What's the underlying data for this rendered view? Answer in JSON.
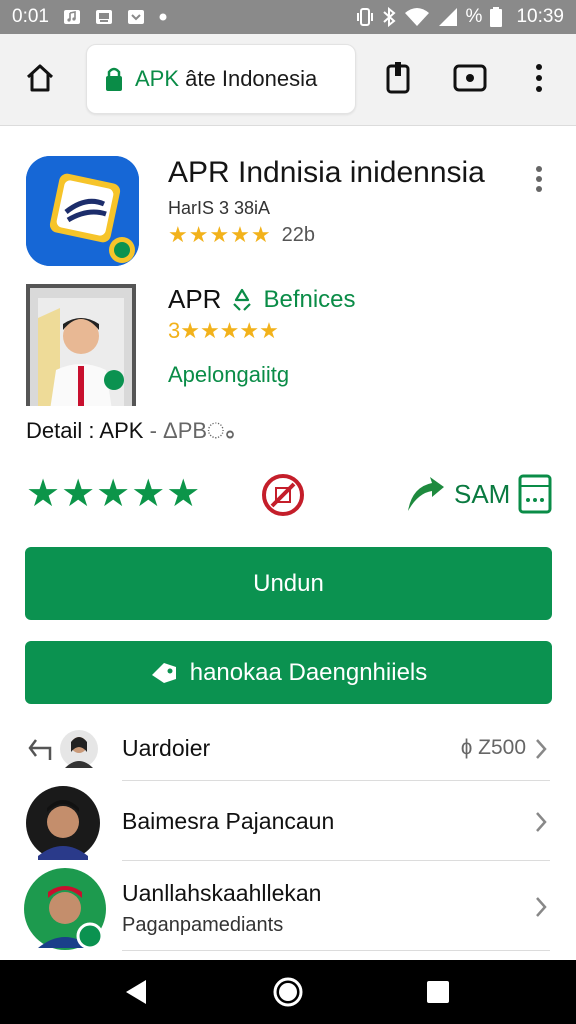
{
  "status_bar": {
    "time_left": "0:01",
    "battery_text": "%",
    "time_right": "10:39"
  },
  "browser": {
    "url_prefix": "APK",
    "url_rest": "âte Indonesia"
  },
  "app": {
    "title": "APR Indnisia inidennsia",
    "subtitle": "HarIS 3 38iA",
    "stars": "★★★★★",
    "rating_count": "22b"
  },
  "developer": {
    "name": "APR",
    "badge_text": "Befnices",
    "stars_text": "3★★★★★",
    "link": "Apelongaiitg"
  },
  "detail": {
    "label": "Detail",
    "sep": ":",
    "value": "APK",
    "tail": "- ΔPBം"
  },
  "badges": {
    "stars": "★★★★★",
    "sim_label": "SАM"
  },
  "buttons": {
    "primary": "Undun",
    "secondary": "hanokaa Daengnhiiels"
  },
  "list": [
    {
      "label": "Uardoier",
      "price": "ɸ Z500"
    },
    {
      "label": "Baimesra Pajancaun"
    },
    {
      "label": "Uanllahskaahllekan",
      "sublabel": "Paganpamediants"
    }
  ],
  "colors": {
    "accent_green": "#0b9250",
    "star_yellow": "#f2b21b",
    "app_icon_blue": "#1667d6"
  },
  "icons": {
    "home": "home-icon",
    "lock": "lock-icon",
    "share": "share-icon",
    "tabs": "tabs-icon",
    "menu": "kebab-menu-icon"
  }
}
